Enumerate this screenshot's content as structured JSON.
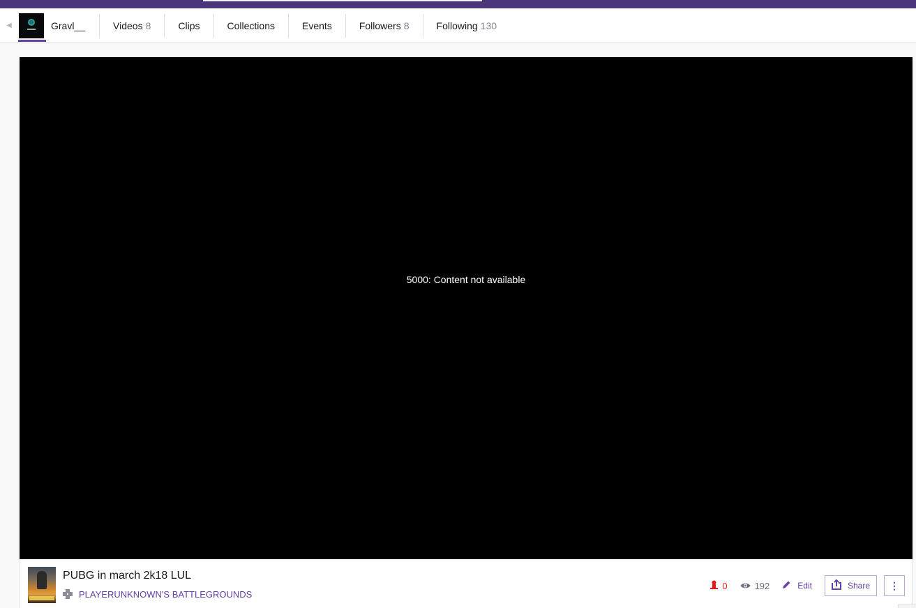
{
  "topbar": {
    "color": "#4b367c"
  },
  "channel": {
    "name": "Gravl__",
    "tabs": [
      {
        "label": "Videos",
        "count": "8"
      },
      {
        "label": "Clips",
        "count": ""
      },
      {
        "label": "Collections",
        "count": ""
      },
      {
        "label": "Events",
        "count": ""
      },
      {
        "label": "Followers",
        "count": "8"
      },
      {
        "label": "Following",
        "count": "130"
      }
    ]
  },
  "player": {
    "error_message": "5000: Content not available"
  },
  "video": {
    "title": "PUBG in march 2k18 LUL",
    "game": "PLAYERUNKNOWN'S BATTLEGROUNDS",
    "viewers_live": "0",
    "views": "192",
    "edit_label": "Edit",
    "share_label": "Share",
    "more_label": "⋮"
  },
  "colors": {
    "accent": "#6441a4",
    "live": "#e91916"
  }
}
